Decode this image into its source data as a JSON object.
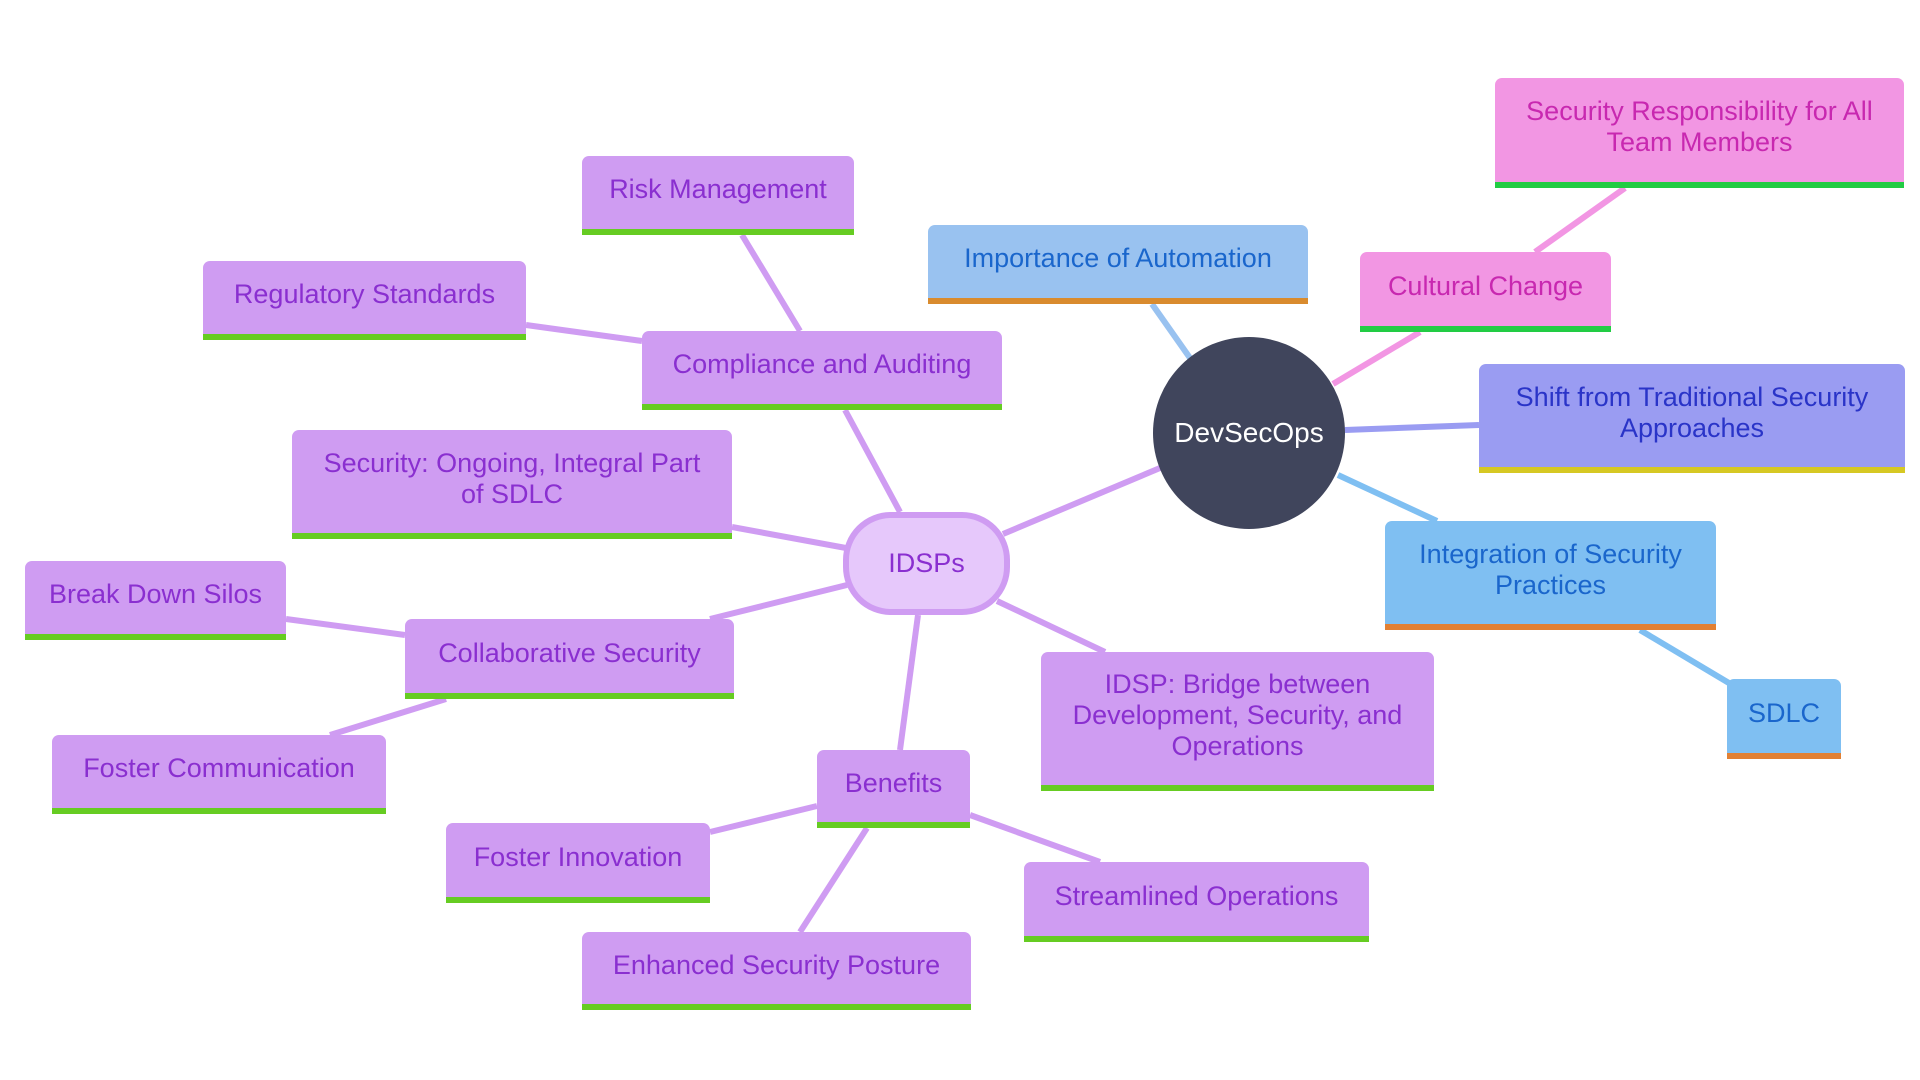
{
  "diagram": {
    "type": "mindmap",
    "root": "DevSecOps",
    "colors": {
      "root_fill": "#40455c",
      "idsps_fill": "#e6c8fb",
      "purple_node": "#cf9cf2",
      "purple_text": "#8a2fd0",
      "purple_edge": "#cf9cf2",
      "green_underline": "#66cc22",
      "blue_node": "#99c2f0",
      "blue_edge": "#99c2f0",
      "pink_node": "#f296e3",
      "violet_node": "#9a9cf2",
      "integration_node": "#7fbff2",
      "orange_underline": "#e28033",
      "yellow_underline": "#d6c823"
    },
    "nodes": {
      "root": "DevSecOps",
      "importance_automation": "Importance of Automation",
      "cultural_change": "Cultural Change",
      "security_responsibility": "Security Responsibility for All Team Members",
      "shift_traditional": "Shift from Traditional Security Approaches",
      "integration_practices": "Integration of Security Practices",
      "sdlc": "SDLC",
      "idsps": "IDSPs",
      "idsp_bridge": "IDSP: Bridge between Development, Security, and Operations",
      "compliance_auditing": "Compliance and Auditing",
      "risk_management": "Risk Management",
      "regulatory_standards": "Regulatory Standards",
      "security_ongoing": "Security: Ongoing, Integral Part of SDLC",
      "collaborative_security": "Collaborative Security",
      "break_down_silos": "Break Down Silos",
      "foster_communication": "Foster Communication",
      "benefits": "Benefits",
      "foster_innovation": "Foster Innovation",
      "streamlined_operations": "Streamlined Operations",
      "enhanced_security_posture": "Enhanced Security Posture"
    },
    "edges": [
      {
        "from": "DevSecOps",
        "to": "Importance of Automation"
      },
      {
        "from": "DevSecOps",
        "to": "Cultural Change"
      },
      {
        "from": "Cultural Change",
        "to": "Security Responsibility for All Team Members"
      },
      {
        "from": "DevSecOps",
        "to": "Shift from Traditional Security Approaches"
      },
      {
        "from": "DevSecOps",
        "to": "Integration of Security Practices"
      },
      {
        "from": "Integration of Security Practices",
        "to": "SDLC"
      },
      {
        "from": "DevSecOps",
        "to": "IDSPs"
      },
      {
        "from": "IDSPs",
        "to": "IDSP: Bridge between Development, Security, and Operations"
      },
      {
        "from": "IDSPs",
        "to": "Compliance and Auditing"
      },
      {
        "from": "Compliance and Auditing",
        "to": "Risk Management"
      },
      {
        "from": "Compliance and Auditing",
        "to": "Regulatory Standards"
      },
      {
        "from": "IDSPs",
        "to": "Security: Ongoing, Integral Part of SDLC"
      },
      {
        "from": "IDSPs",
        "to": "Collaborative Security"
      },
      {
        "from": "Collaborative Security",
        "to": "Break Down Silos"
      },
      {
        "from": "Collaborative Security",
        "to": "Foster Communication"
      },
      {
        "from": "IDSPs",
        "to": "Benefits"
      },
      {
        "from": "Benefits",
        "to": "Foster Innovation"
      },
      {
        "from": "Benefits",
        "to": "Streamlined Operations"
      },
      {
        "from": "Benefits",
        "to": "Enhanced Security Posture"
      }
    ]
  }
}
